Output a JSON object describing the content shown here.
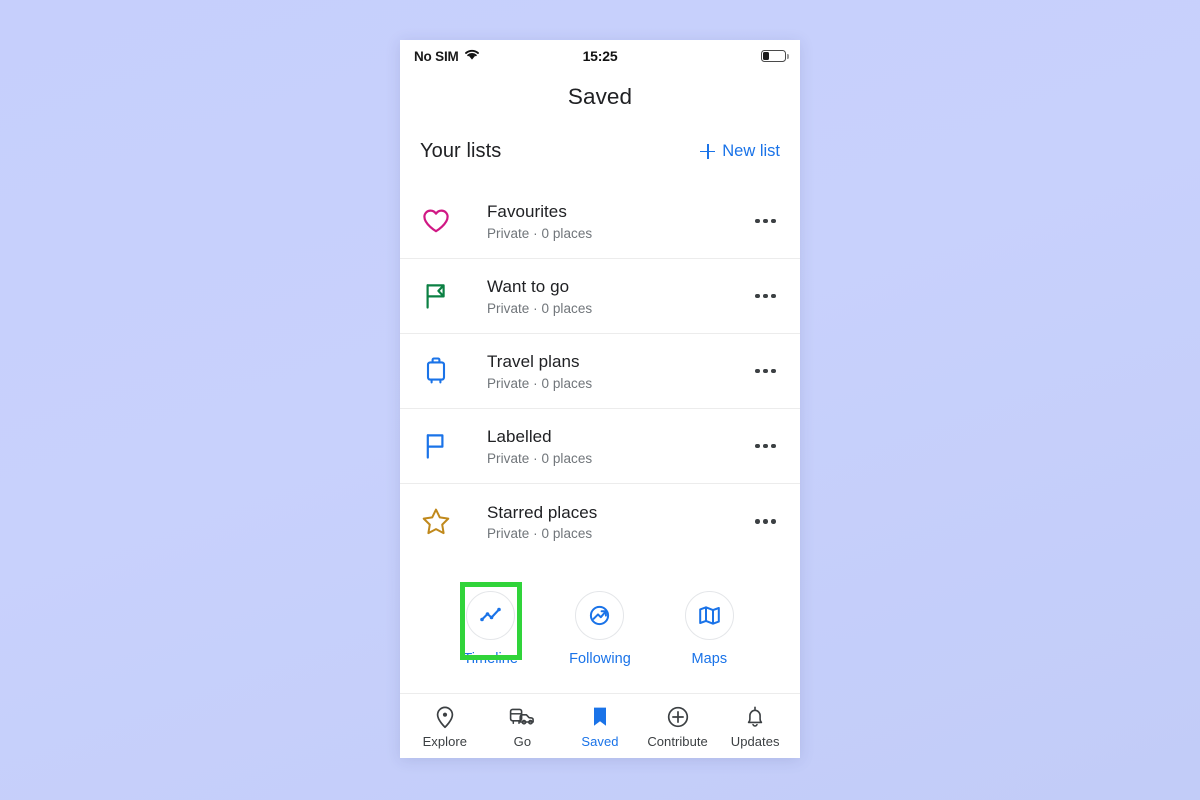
{
  "background_color": "#c6cffc",
  "statusbar": {
    "carrier": "No SIM",
    "wifi_icon": "wifi-icon",
    "time": "15:25",
    "battery_icon": "battery-low-icon",
    "battery_level_pct": 25
  },
  "header": {
    "title": "Saved"
  },
  "section": {
    "title": "Your lists",
    "new_list_label": "New list",
    "new_list_icon": "plus-icon"
  },
  "lists": [
    {
      "name": "Favourites",
      "subtitle": "Private · 0 places",
      "icon": "heart-icon",
      "icon_color": "#d01884",
      "menu_icon": "kebab-menu-icon"
    },
    {
      "name": "Want to go",
      "subtitle": "Private · 0 places",
      "icon": "flag-icon",
      "icon_color": "#0b8043",
      "menu_icon": "kebab-menu-icon"
    },
    {
      "name": "Travel plans",
      "subtitle": "Private · 0 places",
      "icon": "suitcase-icon",
      "icon_color": "#1a73e8",
      "menu_icon": "kebab-menu-icon"
    },
    {
      "name": "Labelled",
      "subtitle": "Private · 0 places",
      "icon": "pin-flag-icon",
      "icon_color": "#1a73e8",
      "menu_icon": "kebab-menu-icon"
    },
    {
      "name": "Starred places",
      "subtitle": "Private · 0 places",
      "icon": "star-icon",
      "icon_color": "#c0891c",
      "menu_icon": "kebab-menu-icon"
    }
  ],
  "shortcuts": [
    {
      "label": "Timeline",
      "icon": "timeline-chart-icon",
      "highlighted": true
    },
    {
      "label": "Following",
      "icon": "following-arrow-icon",
      "highlighted": false
    },
    {
      "label": "Maps",
      "icon": "folded-map-icon",
      "highlighted": false
    }
  ],
  "highlight": {
    "color": "#30d43a"
  },
  "bottom_nav": {
    "accent_color": "#1a73e8",
    "items": [
      {
        "label": "Explore",
        "icon": "location-pin-icon",
        "active": false
      },
      {
        "label": "Go",
        "icon": "transit-car-icon",
        "active": false
      },
      {
        "label": "Saved",
        "icon": "bookmark-filled-icon",
        "active": true
      },
      {
        "label": "Contribute",
        "icon": "plus-circle-icon",
        "active": false
      },
      {
        "label": "Updates",
        "icon": "bell-icon",
        "active": false
      }
    ]
  }
}
